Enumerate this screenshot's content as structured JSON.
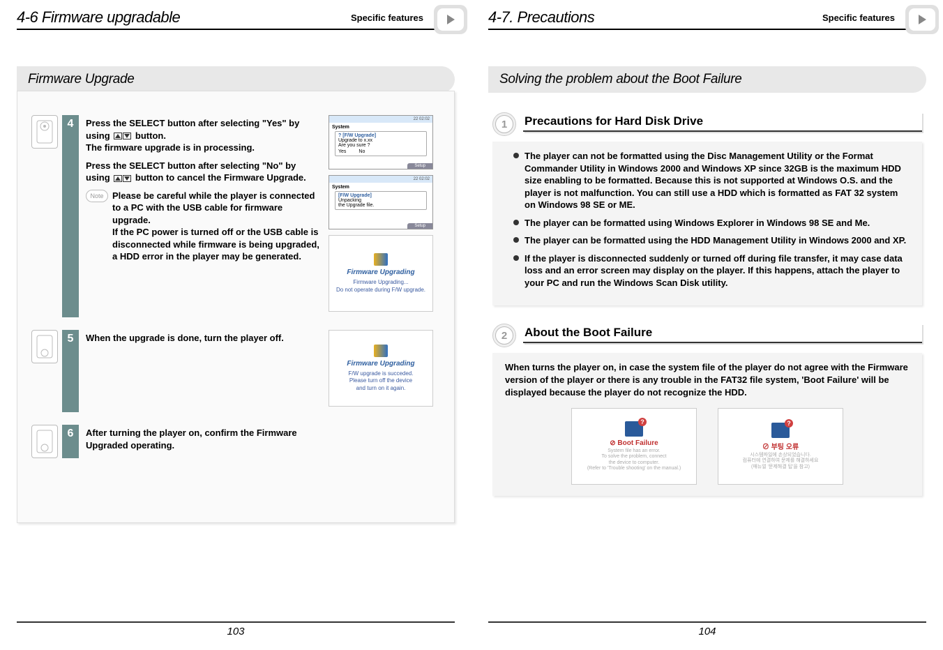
{
  "left": {
    "header_title": "4-6 Firmware upgradable",
    "header_right": "Specific features",
    "section_title": "Firmware Upgrade",
    "steps": [
      {
        "num": "4",
        "text_lines": [
          {
            "bold": true,
            "content": "Press the SELECT button after selecting \"Yes\" by using "
          },
          {
            "bold": true,
            "content_after_arrows": " button."
          },
          {
            "bold": true,
            "content": "The firmware upgrade is in processing."
          },
          {
            "bold": true,
            "content": "Press the SELECT button after selecting \"No\" by using "
          },
          {
            "bold": true,
            "content_after_arrows2": " button to cancel the Firmware Upgrade."
          }
        ],
        "note": "Please be careful while the player is connected to a PC with the USB cable for firmware upgrade.\nIf the PC power is turned off or the USB cable is disconnected while firmware is being upgraded, a HDD error in the player may be generated.",
        "screen1": {
          "top_time": "22    02:02",
          "sys_label": "System",
          "box_title": "[F/W Upgrade]",
          "line1": "Upgrade to    x.xx",
          "line2": "Are you sure ?",
          "opt_yes": "Yes",
          "opt_no": "No",
          "setup": "Setup"
        },
        "screen2": {
          "top_time": "22    02:02",
          "sys_label": "System",
          "box_title": "[F/W Upgrade]",
          "line1": "Unpacking",
          "line2": "the Upgrade file.",
          "setup": "Setup"
        },
        "screen3": {
          "title": "Firmware Upgrading",
          "line1": "Firmware Upgrading...",
          "line2": "Do not operate during F/W upgrade."
        }
      },
      {
        "num": "5",
        "text": "When the upgrade is done, turn the player off.",
        "screen": {
          "title": "Firmware Upgrading",
          "line1": "F/W upgrade is succeded.",
          "line2": "Please turn off the device",
          "line3": "and turn on it again."
        }
      },
      {
        "num": "6",
        "text": "After turning the player on, confirm the Firmware Upgraded operating."
      }
    ],
    "page_number": "103"
  },
  "right": {
    "header_title": "4-7. Precautions",
    "header_right": "Specific features",
    "section_title": "Solving the problem about the Boot Failure",
    "sub1_num": "1",
    "sub1_title": "Precautions for Hard Disk Drive",
    "bullets": [
      "The player can not be formatted using the Disc Management Utility or the Format Commander Utility in Windows 2000 and Windows XP since 32GB is the maximum HDD size enabling to be formatted. Because this is not supported at Windows O.S. and the player is not malfunction. You can still use a HDD which is formatted as FAT 32 system on Windows 98 SE or ME.",
      "The player can be formatted using Windows Explorer in Windows 98 SE and Me.",
      "The player can be formatted using the HDD Management Utility in Windows 2000 and XP.",
      "If the player is disconnected suddenly or turned off during file transfer, it may case data loss and an error screen may display on the player. If this happens, attach the player to your PC and run the Windows Scan Disk utility."
    ],
    "sub2_num": "2",
    "sub2_title": "About the Boot Failure",
    "sub2_intro": "When turns the player on, in case the system file of the player do not agree with the Firmware version of the player or there is any trouble in the FAT32 file system, 'Boot Failure' will be displayed because the player do not recognize the HDD.",
    "boot_img1": {
      "title": "⊘ Boot Failure",
      "line1": "System file has an error.",
      "line2": "To solve the problem, connect",
      "line3": "the device to computer.",
      "line4": "(Refer to 'Trouble shooting' on the manual.)"
    },
    "boot_img2": {
      "title": "⊘ 부팅 오류",
      "line1": "시스템파일에 손상되었습니다.",
      "line2": "컴퓨터에 연결하여 문제를 해결하세요",
      "line3": "(매뉴얼 '문제해결 팁'을 참고)"
    },
    "page_number": "104"
  }
}
